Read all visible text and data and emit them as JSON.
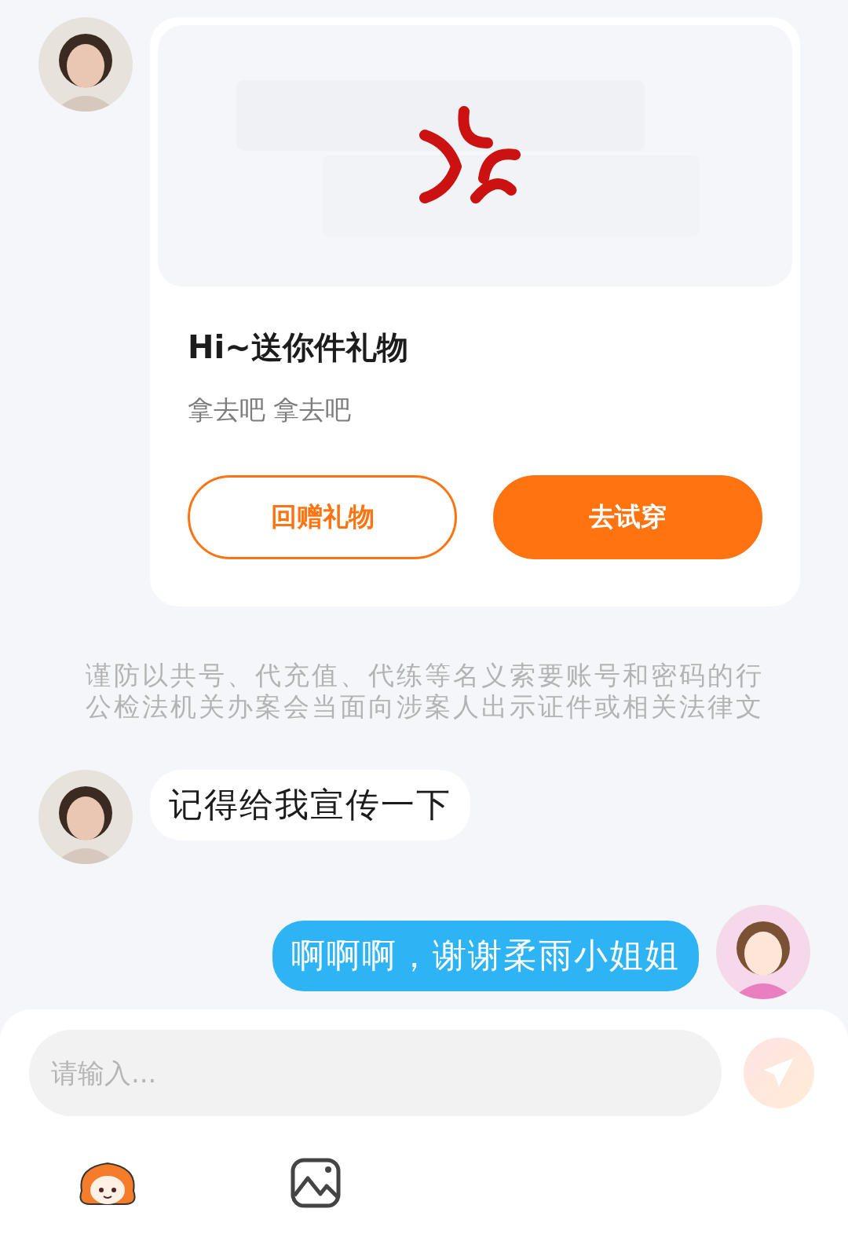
{
  "messages": [
    {
      "kind": "gift",
      "outgoing": false,
      "title": "Hi~送你件礼物",
      "subtitle": "拿去吧 拿去吧",
      "buttons": [
        {
          "label": "回赠礼物",
          "primary": false
        },
        {
          "label": "去试穿",
          "primary": true
        }
      ]
    },
    {
      "kind": "notice",
      "lines": [
        "谨防以共号、代充值、代练等名义索要账号和密码的行",
        "公检法机关办案会当面向涉案人出示证件或相关法律文"
      ]
    },
    {
      "kind": "text",
      "outgoing": false,
      "text": "记得给我宣传一下"
    },
    {
      "kind": "text",
      "outgoing": true,
      "text": "啊啊啊，谢谢柔雨小姐姐"
    }
  ],
  "composer": {
    "placeholder": "请输入...",
    "send_disabled": true
  }
}
